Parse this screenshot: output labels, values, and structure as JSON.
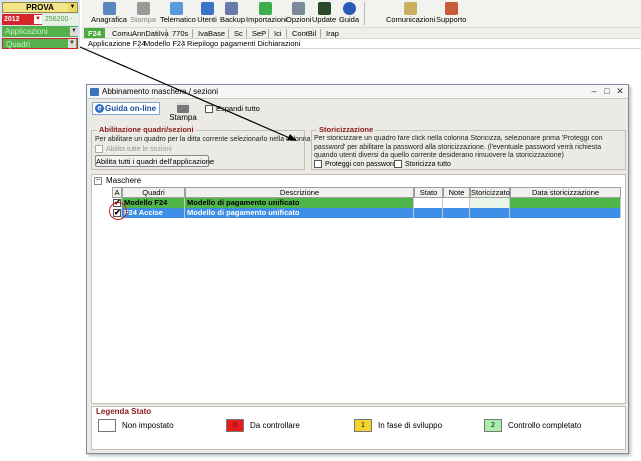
{
  "company": {
    "name": "PROVA",
    "year": "2012",
    "code": "256200",
    "app_selector": "Applicazioni",
    "section_selector": "Quadri"
  },
  "toolbar": [
    {
      "label": "Anagrafica",
      "color": "#5a86c2",
      "icon": "anagrafica-icon"
    },
    {
      "label": "Stampa",
      "color": "#9a9a9a",
      "icon": "printer-icon"
    },
    {
      "label": "Telematico",
      "color": "#5a9ad8",
      "icon": "telematico-icon"
    },
    {
      "label": "Utenti",
      "color": "#3a73c8",
      "icon": "users-icon"
    },
    {
      "label": "Backup",
      "color": "#6a7aa8",
      "icon": "backup-icon"
    },
    {
      "label": "Importazioni",
      "color": "#3fae4a",
      "icon": "import-icon"
    },
    {
      "label": "Opzioni",
      "color": "#7a8a9a",
      "icon": "tools-icon"
    },
    {
      "label": "Update",
      "color": "#2a4a2a",
      "icon": "update-icon"
    },
    {
      "label": "Guida",
      "color": "#2a5ab8",
      "icon": "help-icon"
    },
    {
      "label": "Comunicazioni",
      "color": "#c8b060",
      "icon": "communications-icon"
    },
    {
      "label": "Supporto",
      "color": "#c85a3a",
      "icon": "support-icon"
    }
  ],
  "menu_modules": [
    "F24",
    "ComuAnnDatiIva",
    "770s",
    "IvaBase",
    "Sc",
    "SeP",
    "Ici",
    "ContBil",
    "Irap"
  ],
  "menu_sub": [
    "Applicazione F24",
    "Modello F24",
    "Riepilogo pagamenti Dichiarazioni"
  ],
  "dialog": {
    "title": "Abbinamento maschere / sezioni",
    "guida_label": "Guida on-line",
    "stampa_label": "Stampa",
    "espandi_label": "Espandi tutto",
    "abilitazione": {
      "title": "Abilitazione quadri/sezioni",
      "text": "Per abilitare un quadro per la ditta corrente selezionarlo nella colonna",
      "check_label": "Abilita tutte le sezioni",
      "button_label": "Abilita tutti i quadri dell'applicazione"
    },
    "storicizzazione": {
      "title": "Storicizzazione",
      "text": "Per storicizzare un quadro fare click nella colonna Storicizza, selezionare prima 'Proteggi con password' per abilitare la password alla storicizzazione. (l'eventuale password verrà richiesta quando utenti diversi da quello corrente desiderano rimuovere la storicizzazione)",
      "protect_label": "Proteggi con password",
      "storicizza_label": "Storicizza tutto"
    },
    "tree_label": "Maschere",
    "columns": [
      "A",
      "Quadri",
      "Descrizione",
      "Stato",
      "Note",
      "Storicizzato",
      "Data storicizzazione"
    ],
    "rows": [
      {
        "checked": true,
        "quadro": "Modello F24",
        "descrizione": "Modello di pagamento unificato",
        "stato": "",
        "note": "",
        "storicizzato": "",
        "data": "",
        "style": "green"
      },
      {
        "checked": true,
        "quadro": "F24 Accise",
        "descrizione": "Modello di pagamento unificato",
        "stato": "",
        "note": "",
        "storicizzato": "",
        "data": "",
        "style": "blue"
      }
    ],
    "legend": {
      "title": "Legenda Stato",
      "items": [
        {
          "code": "",
          "label": "Non impostato",
          "color": "#ffffff"
        },
        {
          "code": "0",
          "label": "Da controllare",
          "color": "#e81c1c"
        },
        {
          "code": "1",
          "label": "In fase di sviluppo",
          "color": "#f4d430"
        },
        {
          "code": "2",
          "label": "Controllo completato",
          "color": "#a8eea8"
        }
      ]
    }
  }
}
